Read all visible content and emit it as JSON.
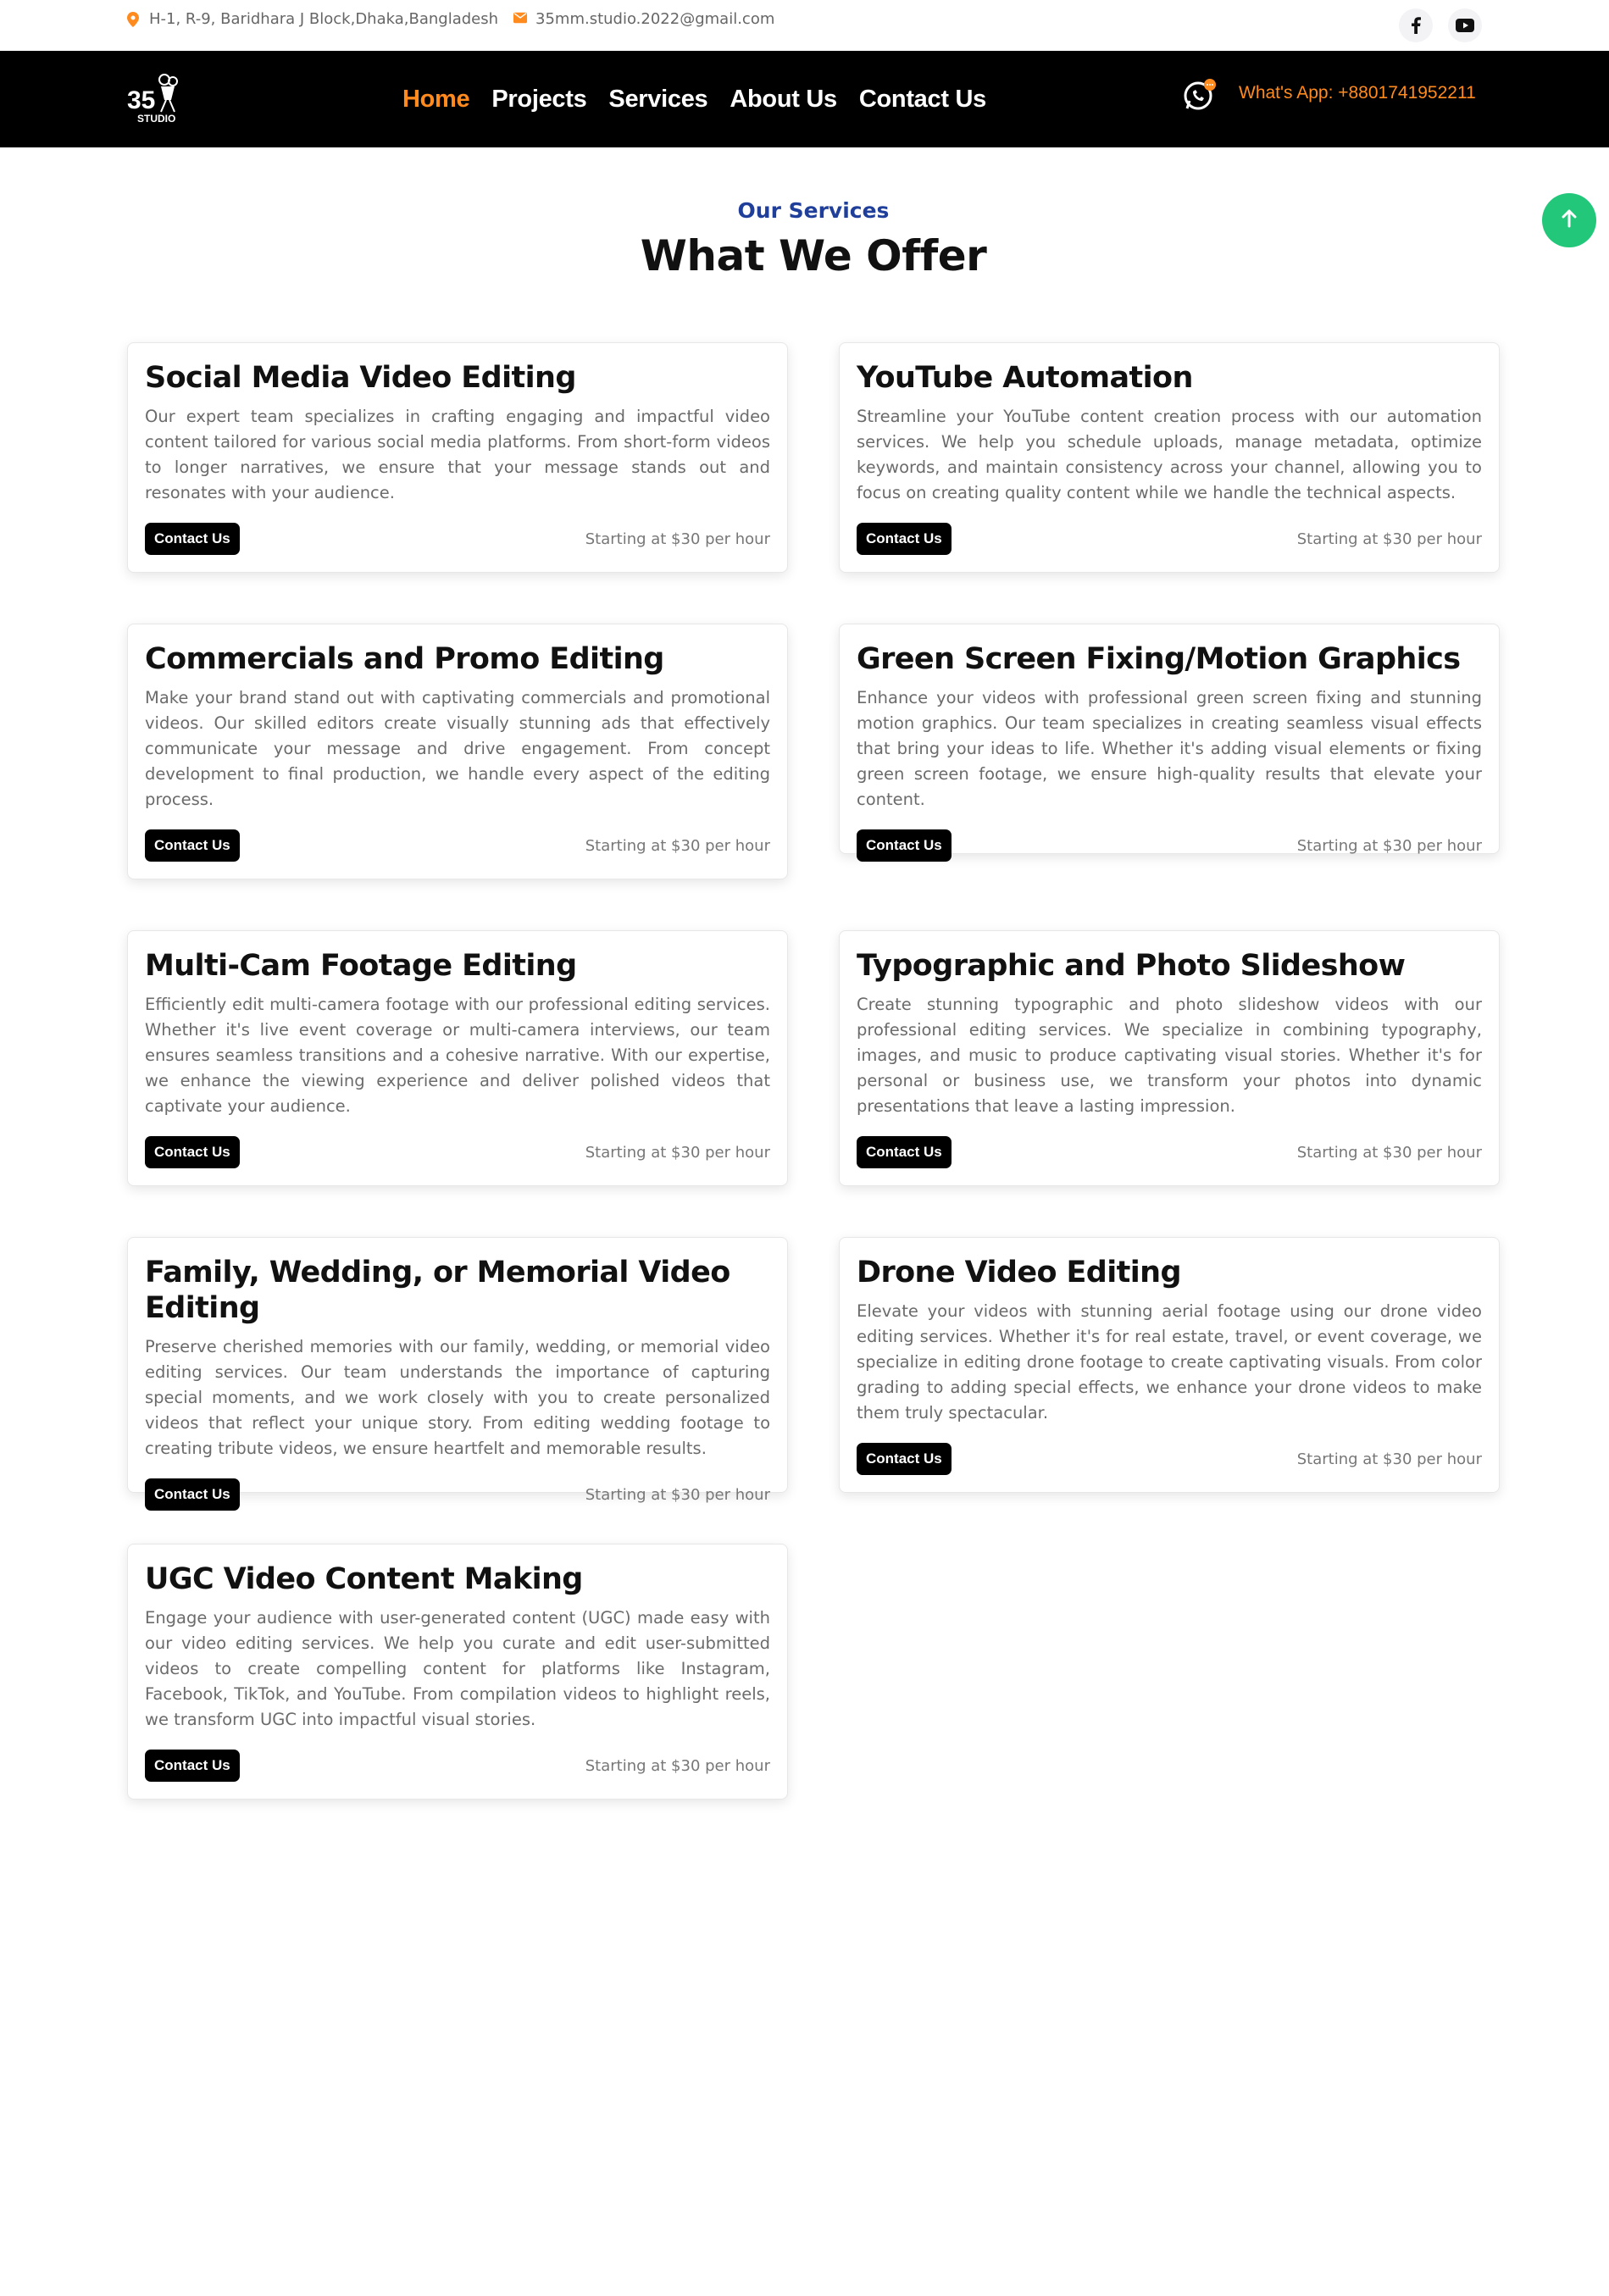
{
  "topbar": {
    "address": "H-1, R-9, Baridhara J Block,Dhaka,Bangladesh",
    "email": "35mm.studio.2022@gmail.com",
    "icons": [
      "map-marker-icon",
      "envelope-icon",
      "facebook-icon",
      "youtube-icon"
    ]
  },
  "nav": {
    "logo_text": "35",
    "logo_sub": "STUDIO",
    "links": [
      "Home",
      "Projects",
      "Services",
      "About Us",
      "Contact Us"
    ],
    "active": "Home",
    "whatsapp": "What's App: +8801741952211"
  },
  "section": {
    "subtitle": "Our Services",
    "title": "What We Offer"
  },
  "services": [
    {
      "title": "Social Media Video Editing",
      "description": "Our expert team specializes in crafting engaging and impactful video content tailored for various social media platforms. From short-form videos to longer narratives, we ensure that your message stands out and resonates with your audience.",
      "button": "Contact Us",
      "price": "Starting at $30 per hour"
    },
    {
      "title": "YouTube Automation",
      "description": "Streamline your YouTube content creation process with our automation services. We help you schedule uploads, manage metadata, optimize keywords, and maintain consistency across your channel, allowing you to focus on creating quality content while we handle the technical aspects.",
      "button": "Contact Us",
      "price": "Starting at $30 per hour"
    },
    {
      "title": "Commercials and Promo Editing",
      "description": "Make your brand stand out with captivating commercials and promotional videos. Our skilled editors create visually stunning ads that effectively communicate your message and drive engagement. From concept development to final production, we handle every aspect of the editing process.",
      "button": "Contact Us",
      "price": "Starting at $30 per hour"
    },
    {
      "title": "Green Screen Fixing/Motion Graphics",
      "description": "Enhance your videos with professional green screen fixing and stunning motion graphics. Our team specializes in creating seamless visual effects that bring your ideas to life. Whether it's adding visual elements or fixing green screen footage, we ensure high-quality results that elevate your content.",
      "button": "Contact Us",
      "price": "Starting at $30 per hour"
    },
    {
      "title": "Multi-Cam Footage Editing",
      "description": "Efficiently edit multi-camera footage with our professional editing services. Whether it's live event coverage or multi-camera interviews, our team ensures seamless transitions and a cohesive narrative. With our expertise, we enhance the viewing experience and deliver polished videos that captivate your audience.",
      "button": "Contact Us",
      "price": "Starting at $30 per hour"
    },
    {
      "title": "Typographic and Photo Slideshow",
      "description": "Create stunning typographic and photo slideshow videos with our professional editing services. We specialize in combining typography, images, and music to produce captivating visual stories. Whether it's for personal or business use, we transform your photos into dynamic presentations that leave a lasting impression.",
      "button": "Contact Us",
      "price": "Starting at $30 per hour"
    },
    {
      "title": "Family, Wedding, or Memorial Video Editing",
      "description": "Preserve cherished memories with our family, wedding, or memorial video editing services. Our team understands the importance of capturing special moments, and we work closely with you to create personalized videos that reflect your unique story. From editing wedding footage to creating tribute videos, we ensure heartfelt and memorable results.",
      "button": "Contact Us",
      "price": "Starting at $30 per hour"
    },
    {
      "title": "Drone Video Editing",
      "description": "Elevate your videos with stunning aerial footage using our drone video editing services. Whether it's for real estate, travel, or event coverage, we specialize in editing drone footage to create captivating visuals. From color grading to adding special effects, we enhance your drone videos to make them truly spectacular.",
      "button": "Contact Us",
      "price": "Starting at $30 per hour"
    },
    {
      "title": "UGC Video Content Making",
      "description": "Engage your audience with user-generated content (UGC) made easy with our video editing services. We help you curate and edit user-submitted videos to create compelling content for platforms like Instagram, Facebook, TikTok, and YouTube. From compilation videos to highlight reels, we transform UGC into impactful visual stories.",
      "button": "Contact Us",
      "price": "Starting at $30 per hour"
    }
  ],
  "colors": {
    "accent": "#ff8a1e",
    "navy": "#1f3f9a",
    "scroll_button": "#22c77a",
    "nav_bg": "#000000"
  }
}
